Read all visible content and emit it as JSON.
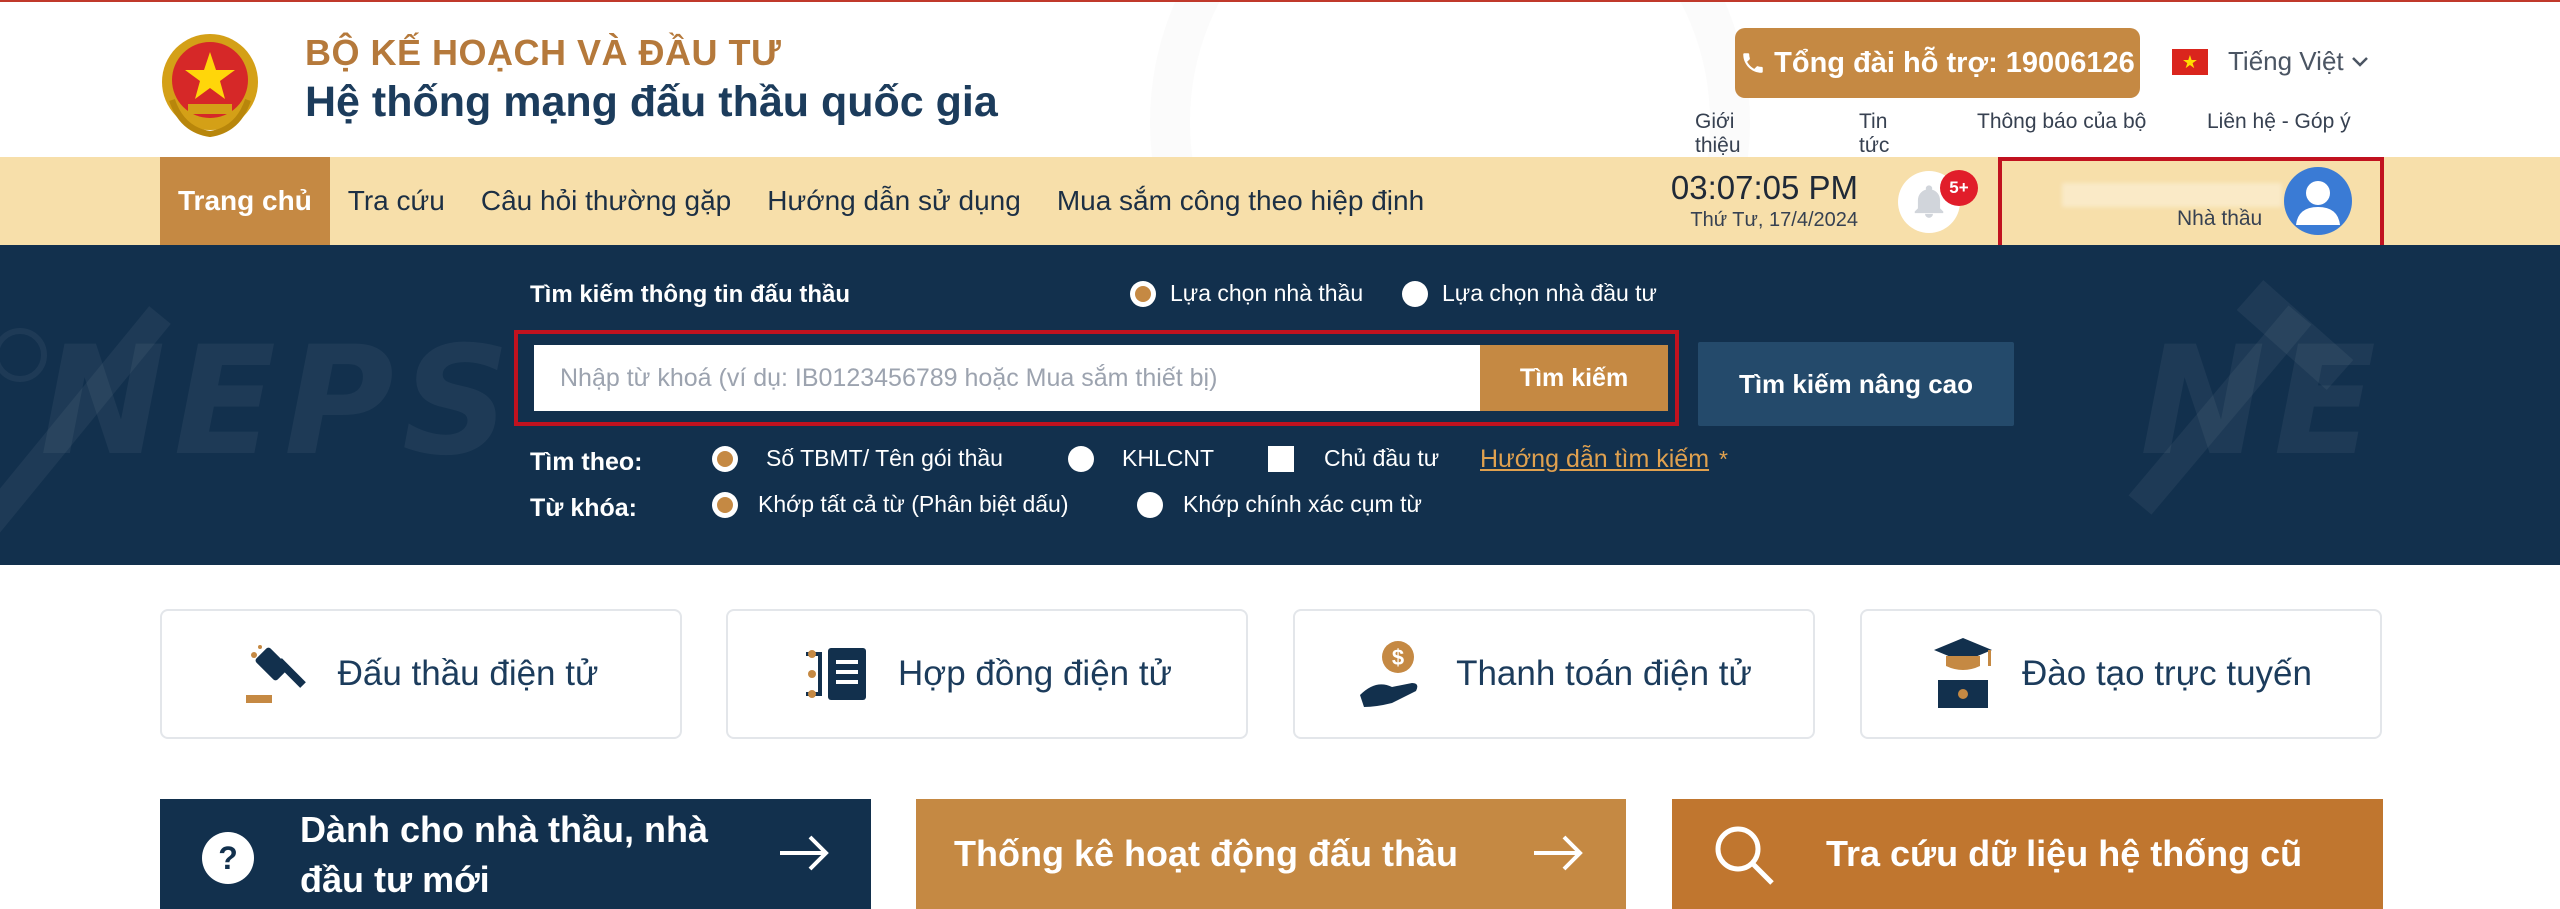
{
  "header": {
    "org_name": "BỘ KẾ HOẠCH VÀ ĐẦU TƯ",
    "system_name": "Hệ thống mạng đấu thầu quốc gia",
    "hotline": "Tổng đài hỗ trợ: 19006126",
    "language": "Tiếng Việt",
    "top_links": [
      "Giới thiệu",
      "Tin tức",
      "Thông báo của bộ",
      "Liên hệ - Góp ý"
    ]
  },
  "nav": {
    "items": [
      "Trang chủ",
      "Tra cứu",
      "Câu hỏi thường gặp",
      "Hướng dẫn sử dụng",
      "Mua sắm công theo hiệp định"
    ],
    "active_index": 0,
    "time": "03:07:05 PM",
    "date": "Thứ Tư, 17/4/2024",
    "notification_badge": "5+",
    "user_role": "Nhà thầu"
  },
  "search": {
    "title": "Tìm kiếm thông tin đấu thầu",
    "mode_options": [
      "Lựa chọn nhà thầu",
      "Lựa chọn nhà đầu tư"
    ],
    "mode_selected": 0,
    "placeholder": "Nhập từ khoá (ví dụ: IB0123456789 hoặc Mua sắm thiết bị)",
    "button_label": "Tìm kiếm",
    "advanced_label": "Tìm kiếm nâng cao",
    "search_by_label": "Tìm theo:",
    "search_by_options": [
      "Số TBMT/ Tên gói thầu",
      "KHLCNT",
      "Chủ đầu tư"
    ],
    "keyword_label": "Từ khóa:",
    "keyword_options": [
      "Khớp tất cả từ (Phân biệt dấu)",
      "Khớp chính xác cụm từ"
    ],
    "guide_link": "Hướng dẫn tìm kiếm",
    "guide_star": "*"
  },
  "services": [
    "Đấu thầu điện tử",
    "Hợp đồng điện tử",
    "Thanh toán điện tử",
    "Đào tạo trực tuyến"
  ],
  "tiles": {
    "new_users_line1": "Dành cho nhà thầu, nhà",
    "new_users_line2": "đầu tư mới",
    "stats": "Thống kê hoạt động đấu thầu",
    "legacy": "Tra cứu dữ liệu hệ thống cũ"
  },
  "colors": {
    "navy": "#12304d",
    "gold": "#c58943",
    "nav_bg": "#f7dfaa",
    "highlight_red": "#c1121f"
  }
}
